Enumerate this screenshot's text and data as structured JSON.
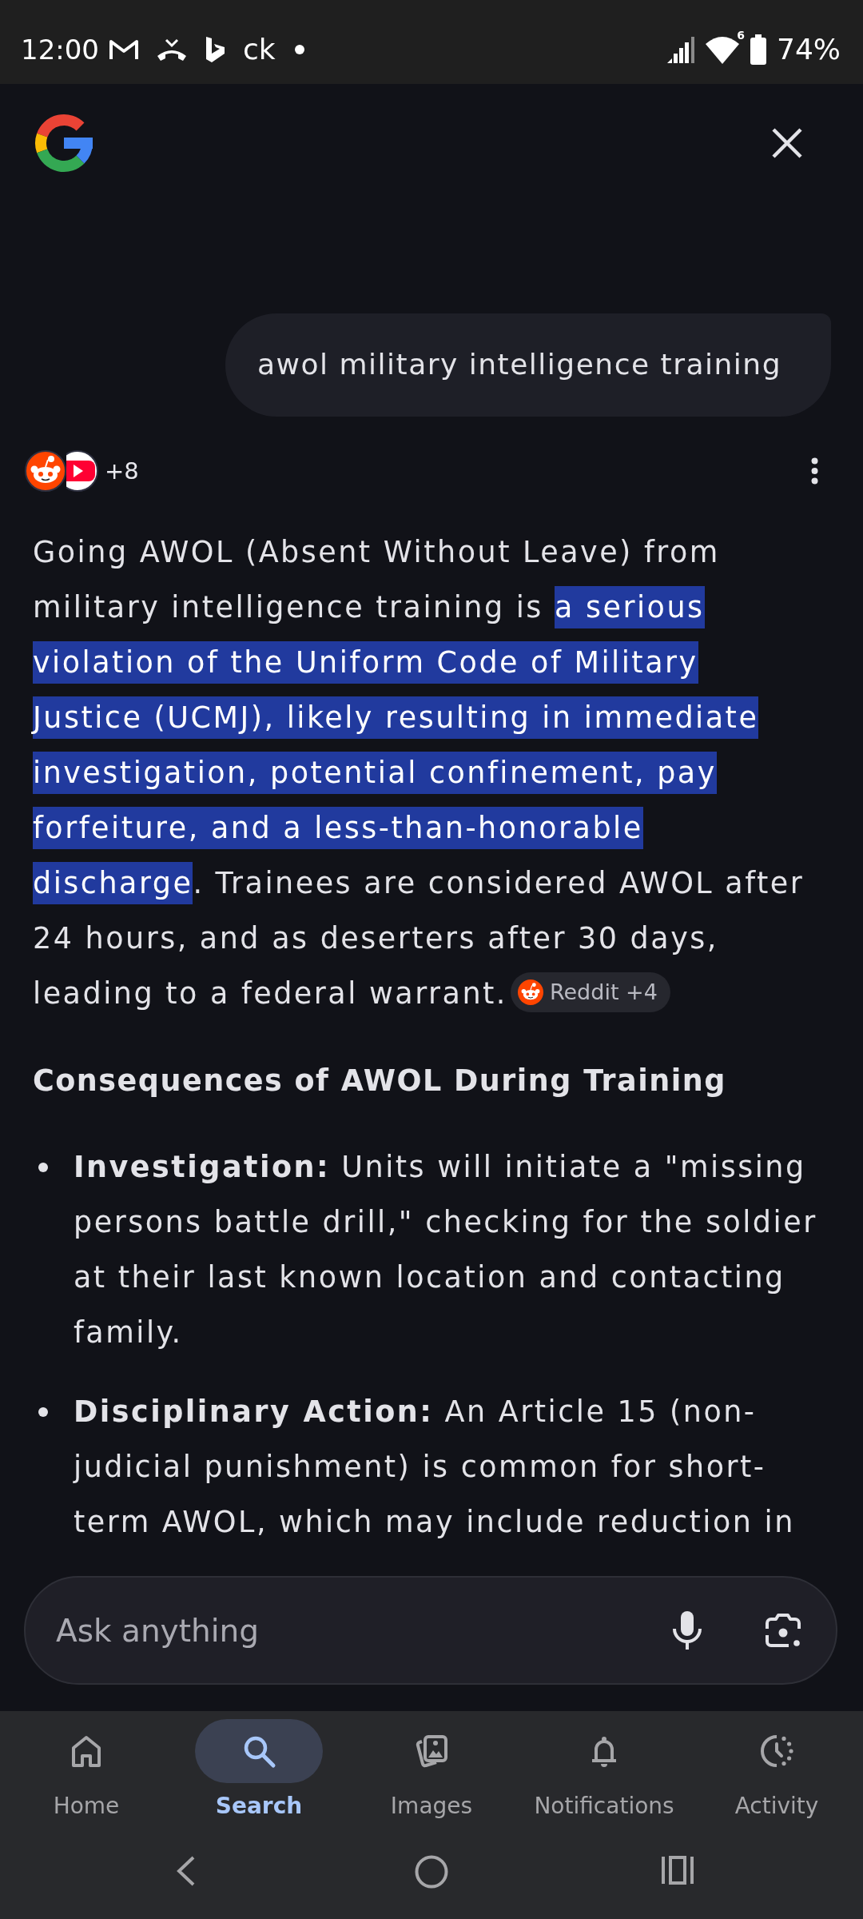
{
  "status_bar": {
    "time": "12:00",
    "app_text": "ck",
    "wifi_badge": "6",
    "battery": "74%"
  },
  "query": {
    "text": "awol military intelligence training"
  },
  "sources": {
    "count": "+8"
  },
  "answer": {
    "segments": [
      {
        "text": "Going AWOL (Absent Without Leave) from military intelligence training is ",
        "highlighted": false
      },
      {
        "text": "a serious violation of the Uniform Code of Military Justice (UCMJ), likely resulting in immediate investigation, potential confinement, pay forfeiture, and a less-than-honorable discharge",
        "highlighted": true
      },
      {
        "text": ". Trainees are considered AWOL after 24 hours, and as deserters after 30 days, leading to a federal warrant.",
        "highlighted": false
      }
    ],
    "citation": {
      "label": "Reddit +4"
    }
  },
  "section": {
    "heading": "Consequences of AWOL During Training",
    "bullets": [
      "**Investigation:** Units will initiate a \"missing persons battle drill,\" checking for the soldier at their last known location and contacting family.",
      "**Disciplinary Action:** An Article 15 (non-judicial punishment) is common for short-term AWOL, which may include reduction in"
    ]
  },
  "ask_bar": {
    "placeholder": "Ask anything"
  },
  "bottom_nav": [
    {
      "label": "Home",
      "selected": false
    },
    {
      "label": "Search",
      "selected": true
    },
    {
      "label": "Images",
      "selected": false
    },
    {
      "label": "Notifications",
      "selected": false
    },
    {
      "label": "Activity",
      "selected": false
    }
  ]
}
